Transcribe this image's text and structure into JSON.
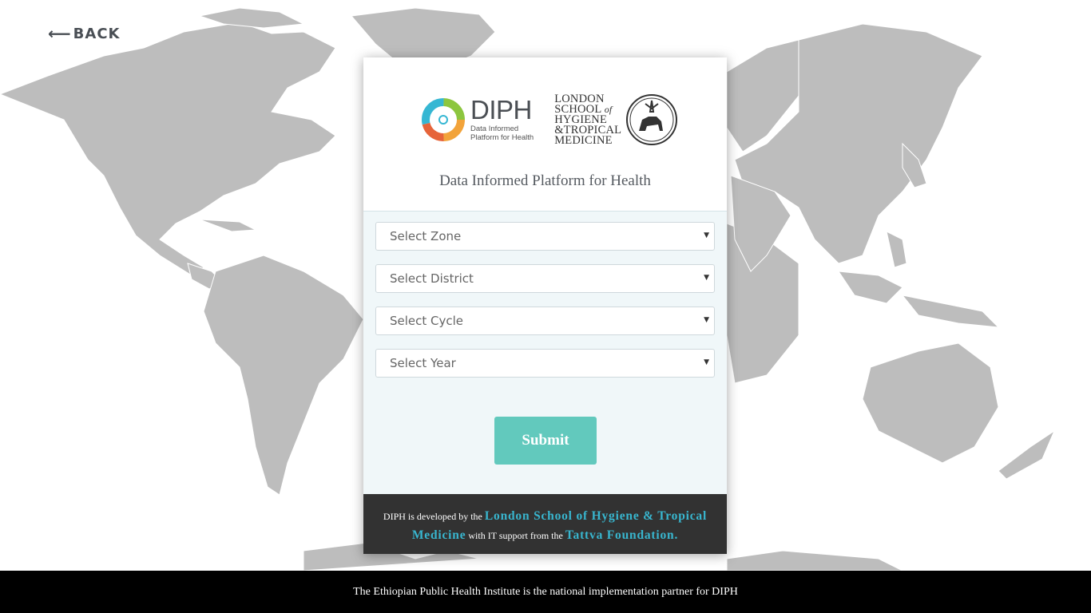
{
  "nav": {
    "back_label": "BACK"
  },
  "header": {
    "diph_logo_title": "DIPH",
    "diph_logo_sub1": "Data Informed",
    "diph_logo_sub2": "Platform for Health",
    "lshtm_line1": "LONDON",
    "lshtm_line2a": "SCHOOL",
    "lshtm_line2b": "of",
    "lshtm_line3": "HYGIENE",
    "lshtm_line4": "&TROPICAL",
    "lshtm_line5": "MEDICINE",
    "subtitle": "Data Informed Platform for Health"
  },
  "form": {
    "zone_placeholder": "Select Zone",
    "district_placeholder": "Select District",
    "cycle_placeholder": "Select Cycle",
    "year_placeholder": "Select Year",
    "submit_label": "Submit"
  },
  "card_footer": {
    "text1": "DIPH is developed by the",
    "link1": "London School of Hygiene & Tropical Medicine",
    "text2": "with IT support from the",
    "link2": "Tattva Foundation."
  },
  "footer": {
    "partner_text": "The Ethiopian Public Health Institute is the national implementation partner for DIPH"
  },
  "colors": {
    "accent": "#62c9bd",
    "link": "#38b6cf",
    "map": "#bdbdbd",
    "footer_bg": "#000000"
  }
}
